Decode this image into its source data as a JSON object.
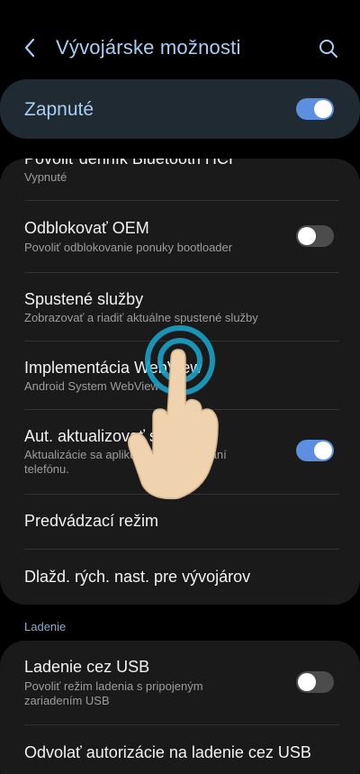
{
  "header": {
    "title": "Vývojárske možnosti",
    "back_icon": "chevron-left-icon",
    "search_icon": "search-icon",
    "accent_color": "#a9cdf3"
  },
  "master": {
    "label": "Zapnuté",
    "state": "on"
  },
  "card1": {
    "partial_item": {
      "title": "Povoliť denník Bluetooth HCI",
      "subtitle": "Vypnuté"
    },
    "oem": {
      "title": "Odblokovať OEM",
      "subtitle": "Povoliť odblokovanie ponuky bootloader",
      "toggle": "off"
    },
    "services": {
      "title": "Spustené služby",
      "subtitle": "Zobrazovať a riadiť aktuálne spustené služby"
    },
    "webview": {
      "title": "Implementácia WebView",
      "subtitle": "Android System WebView"
    },
    "auto_update": {
      "title": "Aut. aktualizovať systém",
      "subtitle": "Aktualizácie sa aplikujú po reštartovaní telefónu.",
      "toggle": "on"
    },
    "demo": {
      "title": "Predvádzací režim"
    },
    "tiles": {
      "title": "Dlažd. rých. nast. pre vývojárov"
    }
  },
  "section": {
    "debugging_header": "Ladenie"
  },
  "card2": {
    "usb_debug": {
      "title": "Ladenie cez USB",
      "subtitle": "Povoliť režim ladenia s pripojeným zariadením USB",
      "toggle": "off"
    },
    "revoke": {
      "title": "Odvolať autorizácie na ladenie cez USB"
    }
  },
  "overlay": {
    "gesture_icon": "tap-hand-icon"
  }
}
